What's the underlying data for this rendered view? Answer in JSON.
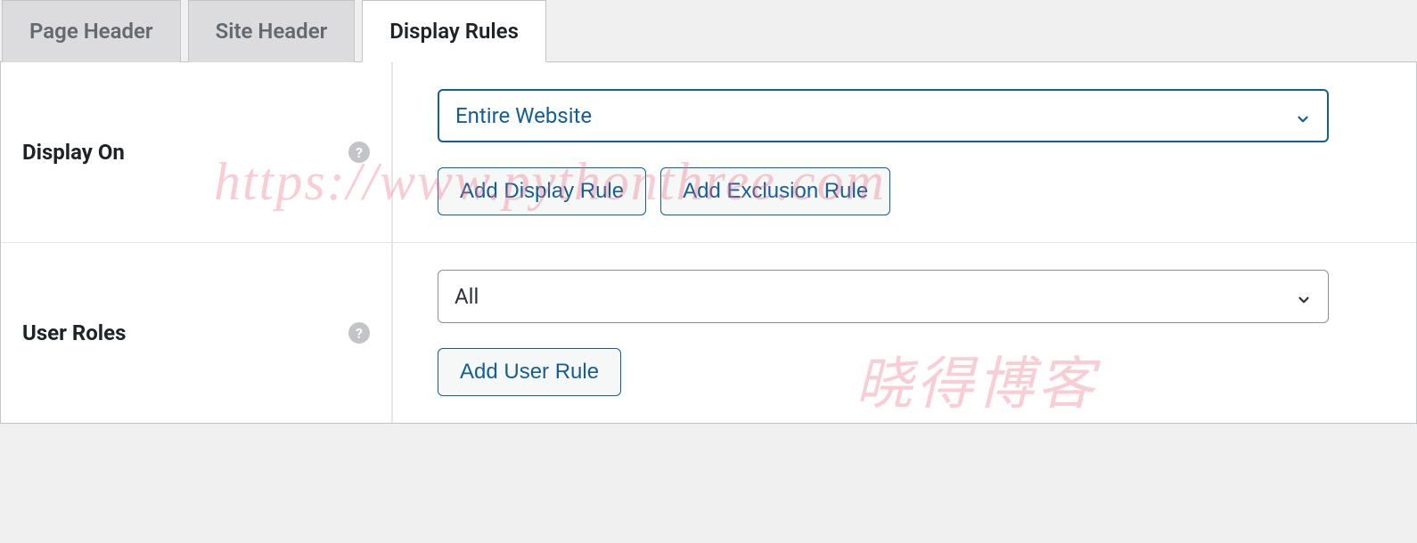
{
  "tabs": [
    {
      "label": "Page Header",
      "active": false
    },
    {
      "label": "Site Header",
      "active": false
    },
    {
      "label": "Display Rules",
      "active": true
    }
  ],
  "fields": {
    "display_on": {
      "label": "Display On",
      "select_value": "Entire Website",
      "add_display_btn": "Add Display Rule",
      "add_exclusion_btn": "Add Exclusion Rule"
    },
    "user_roles": {
      "label": "User Roles",
      "select_value": "All",
      "add_user_btn": "Add User Rule"
    }
  },
  "watermarks": {
    "url": "https://www.pythonthree.com",
    "site_name": "晓得博客"
  }
}
